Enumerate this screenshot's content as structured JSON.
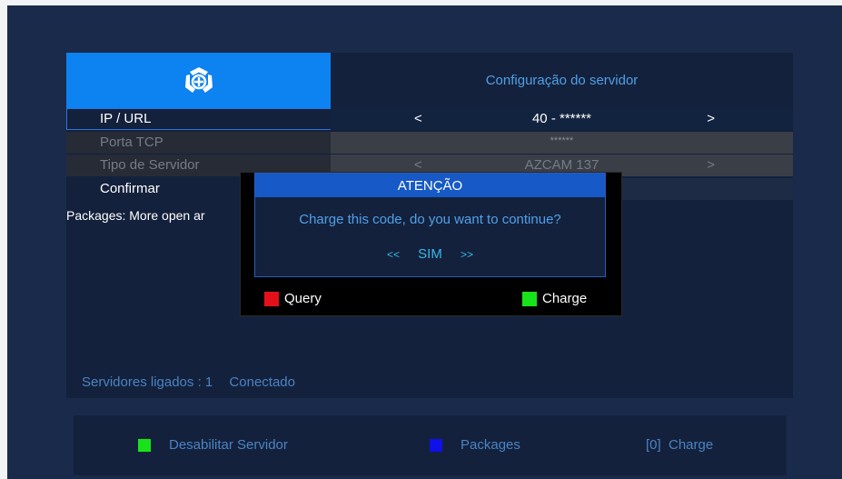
{
  "header": {
    "title": "Configuração do servidor",
    "logo_icon": "azamerica-logo-icon"
  },
  "rows": [
    {
      "label": "IP / URL",
      "value": "40 - ******",
      "arrow_left": "<",
      "arrow_right": ">"
    },
    {
      "label": "Porta TCP",
      "value": "******"
    },
    {
      "label": "Tipo de Servidor",
      "value": "AZCAM 137",
      "arrow_left": "<",
      "arrow_right": ">"
    },
    {
      "label": "Confirmar",
      "value": ""
    }
  ],
  "packages_text": "Packages: More open ar",
  "status": {
    "label": "Servidores ligados : 1",
    "state": "Conectado"
  },
  "dialog": {
    "title": "ATENÇÃO",
    "message": "Charge this code, do you want to continue?",
    "prev": "<<",
    "option": "SIM",
    "next": ">>",
    "red_label": "Query",
    "green_label": "Charge"
  },
  "legend": {
    "green_label": "Desabilitar Servidor",
    "blue_label": "Packages",
    "key_label": "[0]  Charge"
  },
  "colors": {
    "green": "#18e31a",
    "blue": "#1010e8",
    "red": "#e3101a",
    "accent": "#0d82f1"
  }
}
